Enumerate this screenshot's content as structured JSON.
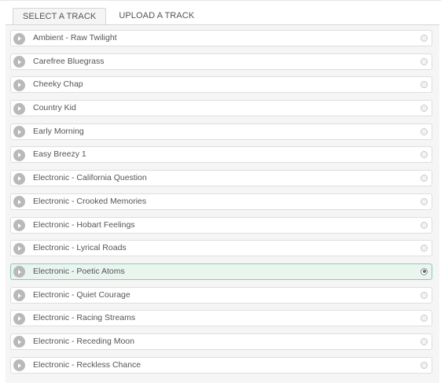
{
  "tabs": {
    "select_label": "SELECT A TRACK",
    "upload_label": "UPLOAD A TRACK",
    "active": "select"
  },
  "tracks": [
    {
      "name": "Ambient - Raw Twilight",
      "selected": false
    },
    {
      "name": "Carefree Bluegrass",
      "selected": false
    },
    {
      "name": "Cheeky Chap",
      "selected": false
    },
    {
      "name": "Country Kid",
      "selected": false
    },
    {
      "name": "Early Morning",
      "selected": false
    },
    {
      "name": "Easy Breezy 1",
      "selected": false
    },
    {
      "name": "Electronic - California Question",
      "selected": false
    },
    {
      "name": "Electronic - Crooked Memories",
      "selected": false
    },
    {
      "name": "Electronic - Hobart Feelings",
      "selected": false
    },
    {
      "name": "Electronic - Lyrical Roads",
      "selected": false
    },
    {
      "name": "Electronic - Poetic Atoms",
      "selected": true
    },
    {
      "name": "Electronic - Quiet Courage",
      "selected": false
    },
    {
      "name": "Electronic - Racing Streams",
      "selected": false
    },
    {
      "name": "Electronic - Receding Moon",
      "selected": false
    },
    {
      "name": "Electronic - Reckless Chance",
      "selected": false
    }
  ],
  "colors": {
    "selected_background": "#eaf5f0",
    "selected_border": "#8fc9ad",
    "play_icon": "#b9b9b9"
  },
  "icons": {
    "play": "play-icon",
    "radio": "radio-button"
  }
}
